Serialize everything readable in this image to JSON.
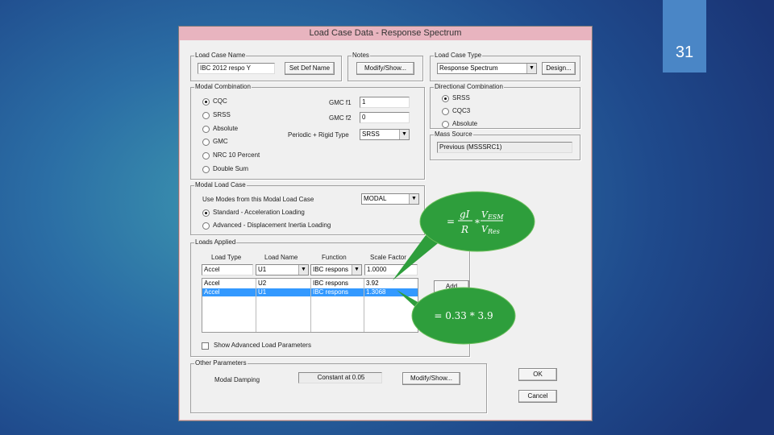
{
  "slide_number": "31",
  "dialog": {
    "title": "Load Case Data - Response Spectrum",
    "load_case_name": {
      "legend": "Load Case Name",
      "value": "IBC 2012 respo Y",
      "button": "Set Def Name"
    },
    "notes": {
      "legend": "Notes",
      "button": "Modify/Show..."
    },
    "load_case_type": {
      "legend": "Load Case Type",
      "value": "Response Spectrum",
      "button": "Design..."
    },
    "modal_combination": {
      "legend": "Modal Combination",
      "options": [
        "CQC",
        "SRSS",
        "Absolute",
        "GMC",
        "NRC 10 Percent",
        "Double Sum"
      ],
      "gmc_f1_label": "GMC f1",
      "gmc_f1_value": "1",
      "gmc_f2_label": "GMC f2",
      "gmc_f2_value": "0",
      "periodic_label": "Periodic + Rigid Type",
      "periodic_value": "SRSS"
    },
    "directional_combination": {
      "legend": "Directional Combination",
      "options": [
        "SRSS",
        "CQC3",
        "Absolute"
      ]
    },
    "mass_source": {
      "legend": "Mass Source",
      "value": "Previous (MSSSRC1)"
    },
    "modal_load_case": {
      "legend": "Modal Load Case",
      "use_modes_label": "Use Modes from this Modal Load Case",
      "use_modes_value": "MODAL",
      "standard_label": "Standard - Acceleration Loading",
      "advanced_label": "Advanced - Displacement Inertia Loading"
    },
    "loads_applied": {
      "legend": "Loads Applied",
      "headers": [
        "Load Type",
        "Load Name",
        "Function",
        "Scale Factor"
      ],
      "edit_row": [
        "Accel",
        "U1",
        "IBC respons",
        "1.0000"
      ],
      "rows": [
        [
          "Accel",
          "U2",
          "IBC respons",
          "3.92"
        ],
        [
          "Accel",
          "U1",
          "IBC respons",
          "1.3068"
        ]
      ],
      "add_button": "Add",
      "show_advanced_label": "Show Advanced Load Parameters"
    },
    "other_parameters": {
      "legend": "Other Parameters",
      "modal_damping_label": "Modal Damping",
      "modal_damping_value": "Constant at 0.05",
      "button": "Modify/Show..."
    },
    "ok_button": "OK",
    "cancel_button": "Cancel"
  },
  "callouts": {
    "upper": "= gI/R * V_ESM/V_Res",
    "lower": "= 0.33 * 3.9",
    "color": "#2e9e3c"
  }
}
